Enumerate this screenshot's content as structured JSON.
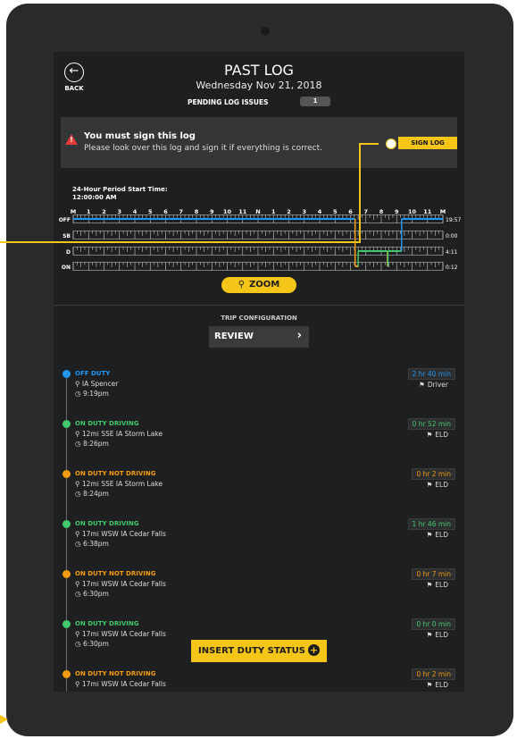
{
  "header": {
    "back_label": "BACK",
    "title": "PAST LOG",
    "subtitle": "Wednesday Nov 21, 2018",
    "pending_label": "PENDING LOG ISSUES",
    "pending_count": "1"
  },
  "alert": {
    "icon": "warning-icon",
    "title": "You must sign this log",
    "message": "Please look over this log and sign it if everything is correct.",
    "button_label": "SIGN LOG"
  },
  "graph": {
    "period_label": "24-Hour Period Start Time:",
    "period_time": "12:00:00 AM",
    "hour_labels": [
      "M",
      "1",
      "2",
      "3",
      "4",
      "5",
      "6",
      "7",
      "8",
      "9",
      "10",
      "11",
      "N",
      "1",
      "2",
      "3",
      "4",
      "5",
      "6",
      "7",
      "8",
      "9",
      "10",
      "11",
      "M"
    ],
    "rows": [
      {
        "label": "OFF",
        "total": "19:57"
      },
      {
        "label": "SB",
        "total": "0:00"
      },
      {
        "label": "D",
        "total": "4:11"
      },
      {
        "label": "ON",
        "total": "0:12"
      }
    ]
  },
  "zoom_label": "ZOOM",
  "trip": {
    "label": "TRIP CONFIGURATION",
    "review_label": "REVIEW"
  },
  "events": [
    {
      "status": "OFF DUTY",
      "color": "#2196f3",
      "location": "IA Spencer",
      "time": "9:19pm",
      "duration": "2 hr 40 min",
      "origin": "Driver"
    },
    {
      "status": "ON DUTY DRIVING",
      "color": "#43c86b",
      "location": "12mi SSE IA Storm Lake",
      "time": "8:26pm",
      "duration": "0 hr 52 min",
      "origin": "ELD"
    },
    {
      "status": "ON DUTY NOT DRIVING",
      "color": "#f39c12",
      "location": "12mi SSE IA Storm Lake",
      "time": "8:24pm",
      "duration": "0 hr 2 min",
      "origin": "ELD"
    },
    {
      "status": "ON DUTY DRIVING",
      "color": "#43c86b",
      "location": "17mi WSW IA Cedar Falls",
      "time": "6:38pm",
      "duration": "1 hr 46 min",
      "origin": "ELD"
    },
    {
      "status": "ON DUTY NOT DRIVING",
      "color": "#f39c12",
      "location": "17mi WSW IA Cedar Falls",
      "time": "6:30pm",
      "duration": "0 hr 7 min",
      "origin": "ELD"
    },
    {
      "status": "ON DUTY DRIVING",
      "color": "#43c86b",
      "location": "17mi WSW IA Cedar Falls",
      "time": "6:30pm",
      "duration": "0 hr 0 min",
      "origin": "ELD"
    },
    {
      "status": "ON DUTY NOT DRIVING",
      "color": "#f39c12",
      "location": "17mi WSW IA Cedar Falls",
      "time": "",
      "duration": "0 hr 2 min",
      "origin": "ELD"
    }
  ],
  "insert_label": "INSERT DUTY STATUS",
  "colors": {
    "accent": "#f5c518",
    "off_duty": "#2196f3",
    "driving": "#43c86b",
    "on_duty": "#f39c12",
    "alert": "#e53935"
  }
}
